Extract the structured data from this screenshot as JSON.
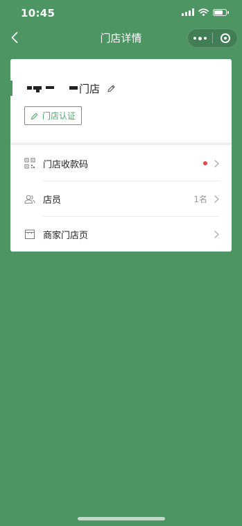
{
  "status_bar": {
    "time": "10:45"
  },
  "nav": {
    "title": "门店详情"
  },
  "store": {
    "name_suffix": "门店",
    "verify_label": "门店认证"
  },
  "menu": [
    {
      "label": "门店收款码",
      "icon": "qr-code-icon",
      "badge": "red-dot",
      "value": ""
    },
    {
      "label": "店员",
      "icon": "staff-icon",
      "value": "1名"
    },
    {
      "label": "商家门店页",
      "icon": "storefront-icon",
      "value": ""
    }
  ],
  "colors": {
    "background": "#4e9564",
    "accent": "#4fa86a",
    "badge": "#e5484d",
    "card": "#ffffff"
  }
}
